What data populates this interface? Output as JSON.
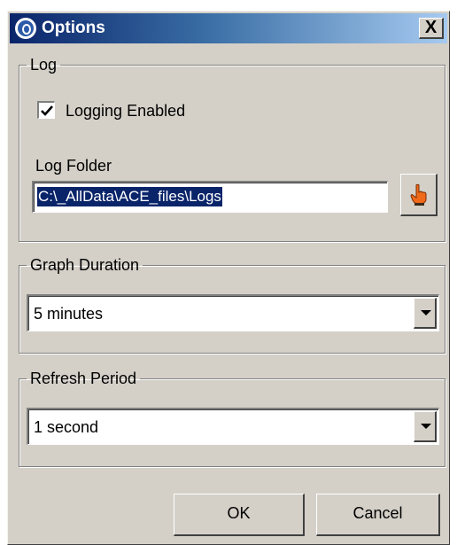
{
  "window": {
    "title": "Options",
    "close_glyph": "X",
    "app_icon": "app-logo-icon"
  },
  "log_group": {
    "legend": "Log",
    "logging_enabled": {
      "label": "Logging Enabled",
      "checked": true
    },
    "log_folder_label": "Log Folder",
    "log_folder_value": "C:\\_AllData\\ACE_files\\Logs",
    "browse_icon": "hand-pointer-icon"
  },
  "graph_duration": {
    "legend": "Graph Duration",
    "selected": "5 minutes"
  },
  "refresh_period": {
    "legend": "Refresh Period",
    "selected": "1 second"
  },
  "buttons": {
    "ok": "OK",
    "cancel": "Cancel"
  },
  "colors": {
    "titlebar_start": "#0a246a",
    "titlebar_end": "#a6caf0",
    "dialog_bg": "#d4d0c8",
    "selection": "#0a246a"
  }
}
